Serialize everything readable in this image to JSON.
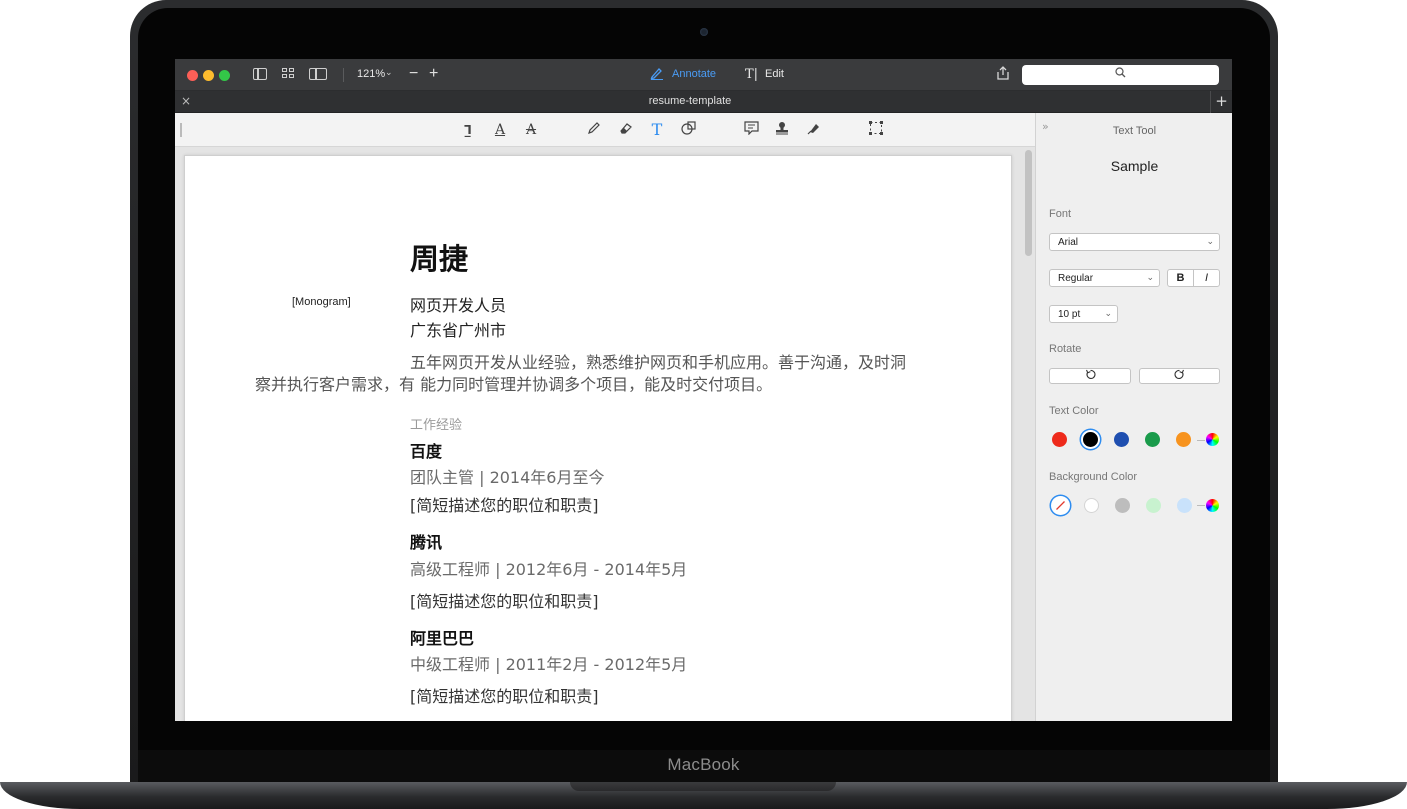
{
  "device": {
    "brand": "MacBook"
  },
  "titlebar": {
    "zoom_level": "121%",
    "zoom_out": "−",
    "zoom_in": "+",
    "annotate_label": "Annotate",
    "edit_label": "Edit"
  },
  "tab": {
    "title": "resume-template",
    "close": "×",
    "add": "+"
  },
  "annotation_tools": [
    "text-box-icon",
    "highlight-icon",
    "strikethrough-icon",
    "pencil-icon",
    "eraser-icon",
    "text-tool-icon",
    "shapes-icon",
    "note-icon",
    "stamp-icon",
    "signature-icon",
    "selection-icon"
  ],
  "resume": {
    "name": "周捷",
    "monogram": "[Monogram]",
    "role": "网页开发人员",
    "city": "广东省广州市",
    "summary_line1": "五年网页开发从业经验，熟悉维护网页和手机应用。善于沟通，及时洞",
    "summary_line2": "察并执行客户需求，有 能力同时管理并协调多个项目，能及时交付项目。",
    "section_title": "工作经验",
    "jobs": [
      {
        "company": "百度",
        "position": "团队主管 | 2014年6月至今",
        "description": "[简短描述您的职位和职责]"
      },
      {
        "company": "腾讯",
        "position": "高级工程师 |  2012年6月 - 2014年5月",
        "description": "[简短描述您的职位和职责]"
      },
      {
        "company": "阿里巴巴",
        "position": "中级工程师 |  2011年2月 - 2012年5月",
        "description": "[简短描述您的职位和职责]"
      }
    ]
  },
  "panel": {
    "title": "Text Tool",
    "sample": "Sample",
    "font_label": "Font",
    "font_value": "Arial",
    "style_value": "Regular",
    "bold_label": "B",
    "italic_label": "I",
    "size_value": "10 pt",
    "rotate_label": "Rotate",
    "text_color_label": "Text Color",
    "background_color_label": "Background Color",
    "text_colors": [
      "#ee2a1b",
      "#000000",
      "#1f4fb0",
      "#1a9b4b",
      "#f7931e"
    ],
    "background_colors": [
      "#ffffff",
      "#bdbdbd",
      "#c8f2cf",
      "#c9e2fb"
    ],
    "accent_color": "#2d8cf0"
  }
}
